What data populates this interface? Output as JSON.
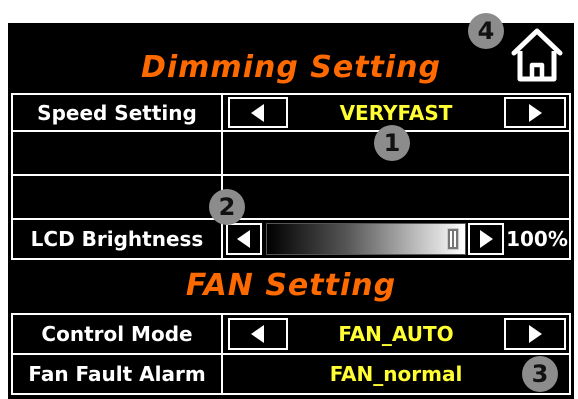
{
  "dimming": {
    "title": "Dimming Setting",
    "speed_label": "Speed Setting",
    "speed_value": "VERYFAST"
  },
  "lcd": {
    "label": "LCD Brightness",
    "percent": "100%",
    "level": 1.0
  },
  "fan": {
    "title": "FAN Setting",
    "control_label": "Control Mode",
    "control_value": "FAN_AUTO",
    "fault_label": "Fan Fault Alarm",
    "fault_value": "FAN_normal"
  },
  "callouts": [
    "1",
    "2",
    "3",
    "4"
  ],
  "colors": {
    "background": "#000000",
    "title": "#ff6a00",
    "value": "#ffff33",
    "badge": "#8c8c8c"
  },
  "icons": {
    "left": "left-arrow-icon",
    "right": "right-arrow-icon",
    "home": "home-icon"
  }
}
